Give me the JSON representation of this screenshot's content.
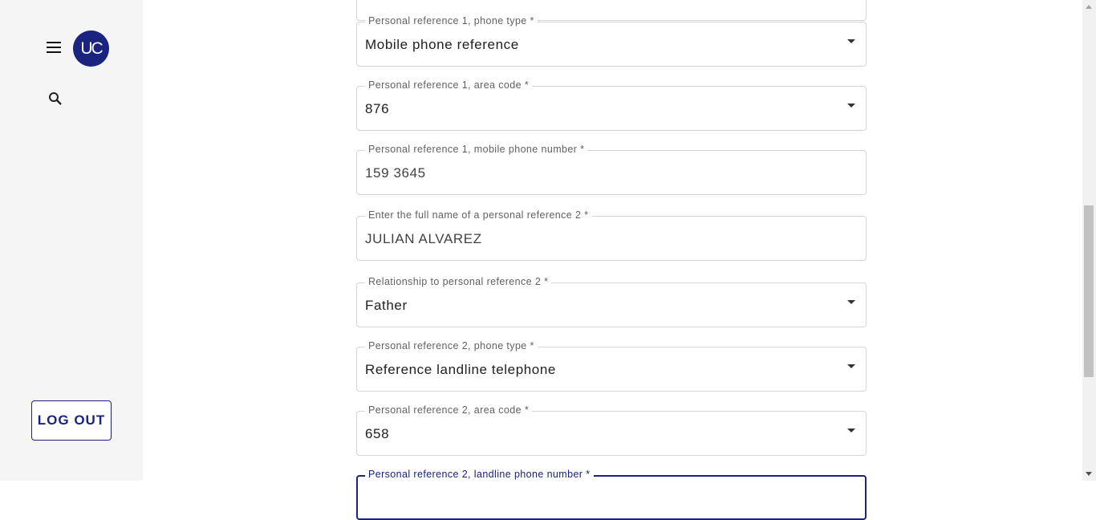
{
  "sidebar": {
    "menu_icon": "hamburger-menu-icon",
    "avatar_initials": "UC",
    "search_icon": "search-icon",
    "logout_label": "LOG OUT"
  },
  "form": {
    "fields": [
      {
        "label": "Personal reference 1, phone type *",
        "value": "Mobile phone reference",
        "type": "select"
      },
      {
        "label": "Personal reference 1, area code *",
        "value": "876",
        "type": "select"
      },
      {
        "label": "Personal reference 1, mobile phone number *",
        "value": "159 3645",
        "type": "text"
      },
      {
        "label": "Enter the full name of a personal reference 2 *",
        "value": "JULIAN ALVAREZ",
        "type": "text"
      },
      {
        "label": "Relationship to personal reference 2 *",
        "value": "Father",
        "type": "select"
      },
      {
        "label": "Personal reference 2, phone type *",
        "value": "Reference landline telephone",
        "type": "select"
      },
      {
        "label": "Personal reference 2, area code *",
        "value": "658",
        "type": "select"
      },
      {
        "label": "Personal reference 2, landline phone number *",
        "value": "",
        "type": "text"
      }
    ]
  },
  "colors": {
    "primary": "#1a237e",
    "sidebar_bg": "#f5f5f5",
    "border": "#d4d4d4"
  }
}
